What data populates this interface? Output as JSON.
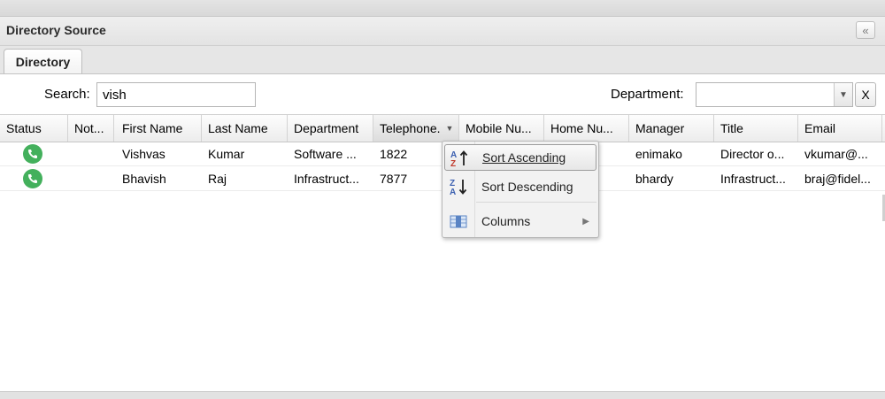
{
  "panel": {
    "title": "Directory Source",
    "collapse_icon": "«"
  },
  "tabs": [
    {
      "label": "Directory"
    }
  ],
  "toolbar": {
    "search_label": "Search:",
    "search_value": "vish",
    "department_label": "Department:",
    "department_value": "",
    "clear_label": "X"
  },
  "columns": [
    {
      "label": "Status"
    },
    {
      "label": "Not..."
    },
    {
      "label": "First Name"
    },
    {
      "label": "Last Name"
    },
    {
      "label": "Department"
    },
    {
      "label": "Telephone."
    },
    {
      "label": "Mobile Nu..."
    },
    {
      "label": "Home Nu..."
    },
    {
      "label": "Manager"
    },
    {
      "label": "Title"
    },
    {
      "label": "Email"
    }
  ],
  "rows": [
    {
      "status": "phone-icon",
      "notes": "",
      "first_name": "Vishvas",
      "last_name": "Kumar",
      "department": "Software ...",
      "telephone": "1822",
      "mobile": "",
      "home": "",
      "manager": "enimako",
      "title": "Director o...",
      "email": "vkumar@..."
    },
    {
      "status": "phone-icon",
      "notes": "",
      "first_name": "Bhavish",
      "last_name": "Raj",
      "department": "Infrastruct...",
      "telephone": "7877",
      "mobile": "",
      "home": "",
      "manager": "bhardy",
      "title": "Infrastruct...",
      "email": "braj@fidel..."
    }
  ],
  "column_menu": {
    "items": [
      {
        "label": "Sort Ascending",
        "icon": "sort-ascending-icon"
      },
      {
        "label": "Sort Descending",
        "icon": "sort-descending-icon"
      },
      {
        "label": "Columns",
        "icon": "columns-icon"
      }
    ]
  },
  "colors": {
    "status_green": "#43b05c",
    "header_bg": "#e3e3e3"
  }
}
